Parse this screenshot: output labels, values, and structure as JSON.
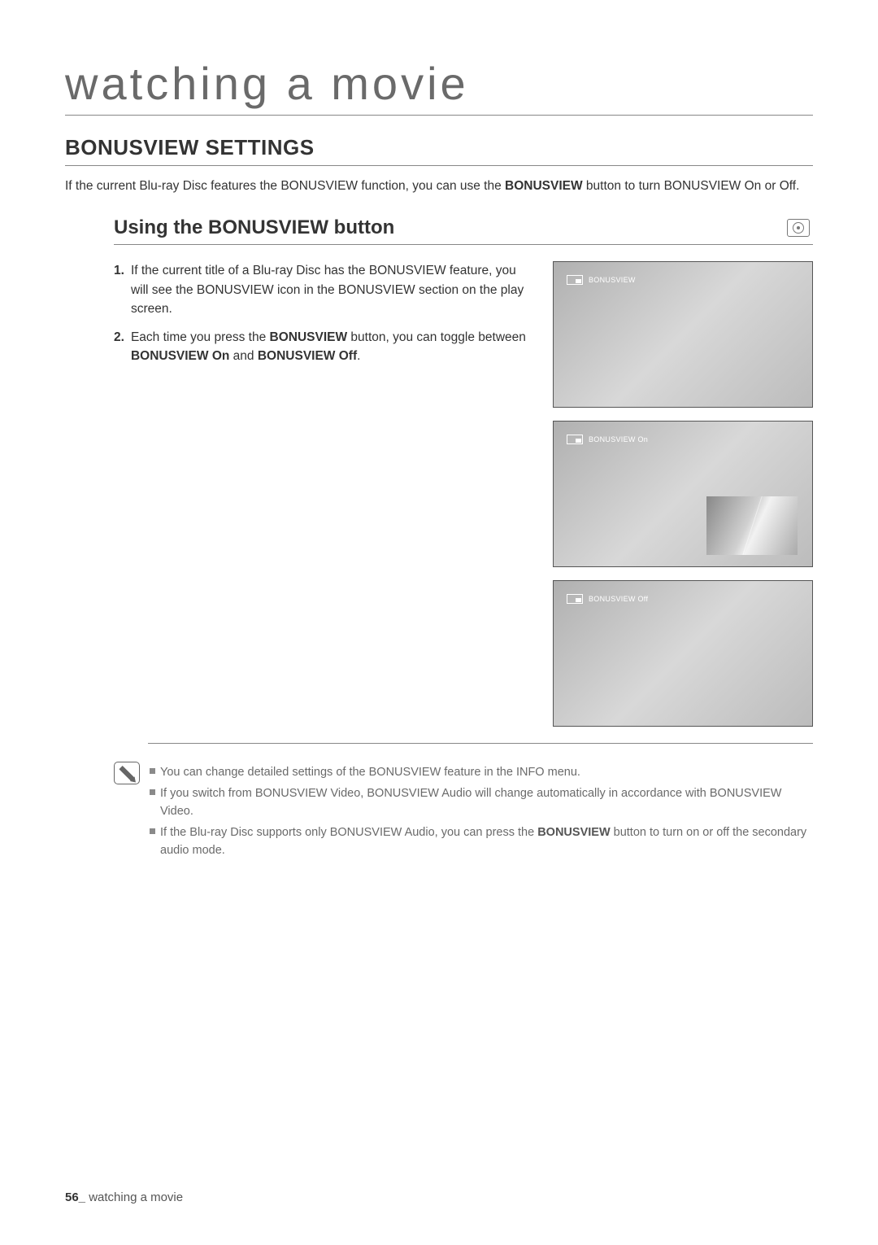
{
  "page": {
    "title": "watching a movie",
    "footer_page": "56_",
    "footer_text": "watching a movie"
  },
  "section": {
    "heading": "BONUSVIEW SETTINGS",
    "intro_p1": "If the current Blu-ray Disc features the BONUSVIEW function, you can use the ",
    "intro_bold": "BONUSVIEW",
    "intro_p2": " button to turn BONUSVIEW On or Off."
  },
  "sub": {
    "heading": "Using the BONUSVIEW button"
  },
  "steps": {
    "s1_num": "1.",
    "s1_text": "If the current title of a Blu-ray Disc has the BONUSVIEW feature,  you will see the BONUSVIEW icon in the BONUSVIEW section on the play screen.",
    "s2_num": "2.",
    "s2_a": "Each time you press the ",
    "s2_b": "BONUSVIEW",
    "s2_c": " button, you can toggle between ",
    "s2_d": "BONUSVIEW On",
    "s2_e": " and ",
    "s2_f": "BONUSVIEW Off",
    "s2_g": "."
  },
  "screens": {
    "s1": "BONUSVIEW",
    "s2": "BONUSVIEW On",
    "s3": "BONUSVIEW Off"
  },
  "notes": {
    "n1": "You can change detailed settings of the BONUSVIEW feature in the INFO menu.",
    "n2": "If you switch from BONUSVIEW Video, BONUSVIEW Audio will change automatically in accordance with BONUSVIEW Video.",
    "n3_a": "If the Blu-ray Disc supports only BONUSVIEW Audio, you can press the ",
    "n3_b": "BONUSVIEW",
    "n3_c": " button to turn on or off the secondary audio mode."
  }
}
